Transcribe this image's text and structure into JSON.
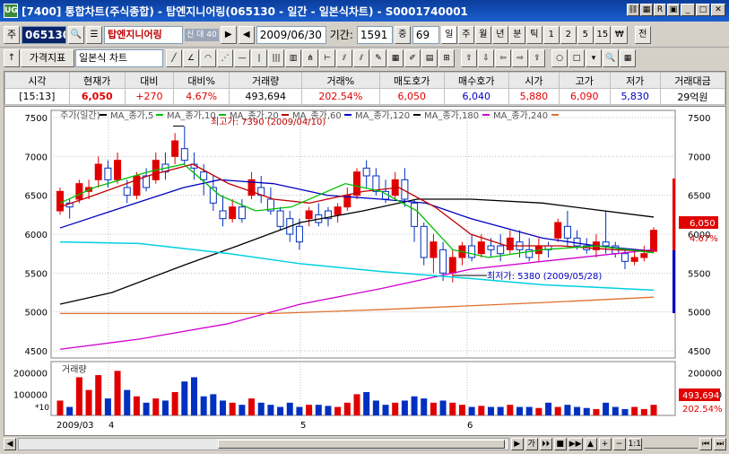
{
  "window": {
    "title": "[7400] 통합차트(주식종합) - 탑엔지니어링(065130 - 일간 - 일본식차트) - S0001740001"
  },
  "toolbar": {
    "market": "주",
    "code": "065130",
    "stock_name": "탑엔지니어링",
    "badge": "신 대 40",
    "date": "2009/06/30",
    "period_label": "기간:",
    "period": "1591",
    "zoom_label": "중",
    "zoom": "69",
    "period_buttons": [
      "일",
      "주",
      "월",
      "년",
      "분",
      "틱",
      "1",
      "2",
      "5",
      "15",
      "₩"
    ],
    "extra": "전",
    "indicator_btn": "가격지표",
    "chart_type": "일본식 차트"
  },
  "quote": {
    "headers": [
      "시각",
      "현재가",
      "대비",
      "대비%",
      "거래량",
      "거래%",
      "매도호가",
      "매수호가",
      "시가",
      "고가",
      "저가",
      "거래대금"
    ],
    "values": [
      "[15:13]",
      "6,050",
      "+270",
      "4.67%",
      "493,694",
      "202.54%",
      "6,050",
      "6,040",
      "5,880",
      "6,090",
      "5,830",
      "29억원"
    ]
  },
  "chart": {
    "legend": [
      "주가(일간)",
      "MA_종가,5",
      "MA_종가,10",
      "MA_종가,20",
      "MA_종가,60",
      "MA_종가,120",
      "MA_종가,180",
      "MA_종가,240"
    ],
    "legend_colors": [
      "#000000",
      "#00c000",
      "#00c000",
      "#c00000",
      "#0000c0",
      "#000000",
      "#d000d0",
      "#e07030"
    ],
    "high_note": "최고가: 7390 (2009/04/10)",
    "low_note": "최저가: 5380 (2009/05/28)",
    "yticks": [
      "7500",
      "7000",
      "6500",
      "6000",
      "5500",
      "5000",
      "4500"
    ],
    "last_price": "6,050",
    "last_pct": "4.67%",
    "volume_label": "거래량",
    "vol_ticks": [
      "200000",
      "100000"
    ],
    "vol_unit": "*10",
    "last_volume": "493,694",
    "last_vol_pct": "202.54%",
    "xlabels": [
      "2009/03",
      "4",
      "5",
      "6"
    ]
  },
  "scroll": {
    "labels": [
      "가",
      "1:1"
    ]
  }
}
